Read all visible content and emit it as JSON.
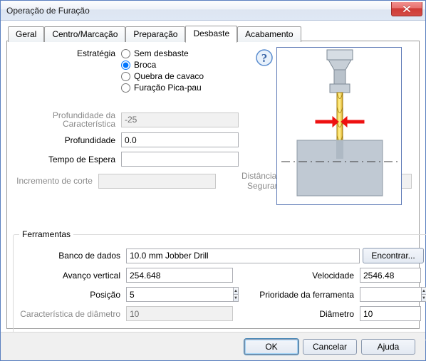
{
  "window": {
    "title": "Operação de Furação"
  },
  "tabs": [
    {
      "label": "Geral"
    },
    {
      "label": "Centro/Marcação"
    },
    {
      "label": "Preparação"
    },
    {
      "label": "Desbaste",
      "active": true
    },
    {
      "label": "Acabamento"
    }
  ],
  "strategy": {
    "label": "Estratégia",
    "options": [
      {
        "label": "Sem desbaste",
        "checked": false
      },
      {
        "label": "Broca",
        "checked": true
      },
      {
        "label": "Quebra de cavaco",
        "checked": false
      },
      {
        "label": "Furação Pica-pau",
        "checked": false
      }
    ]
  },
  "params": {
    "feature_depth_label": "Profundidade da Característica",
    "feature_depth_value": "-25",
    "depth_label": "Profundidade",
    "depth_value": "0.0",
    "dwell_label": "Tempo de Espera",
    "dwell_value": "",
    "cut_increment_label": "Incremento de corte",
    "cut_increment_value": "",
    "safe_distance_label": "Distância de Segurança",
    "safe_distance_value": ""
  },
  "tools": {
    "legend": "Ferramentas",
    "database_label": "Banco de dados",
    "database_value": "10.0 mm Jobber Drill",
    "find_button": "Encontrar...",
    "feed_label": "Avanço vertical",
    "feed_value": "254.648",
    "speed_label": "Velocidade",
    "speed_value": "2546.48",
    "position_label": "Posição",
    "position_value": "5",
    "priority_label": "Prioridade da ferramenta",
    "priority_value": "",
    "diam_char_label": "Característica de diâmetro",
    "diam_char_value": "10",
    "diameter_label": "Diâmetro",
    "diameter_value": "10"
  },
  "buttons": {
    "ok": "OK",
    "cancel": "Cancelar",
    "help": "Ajuda"
  }
}
